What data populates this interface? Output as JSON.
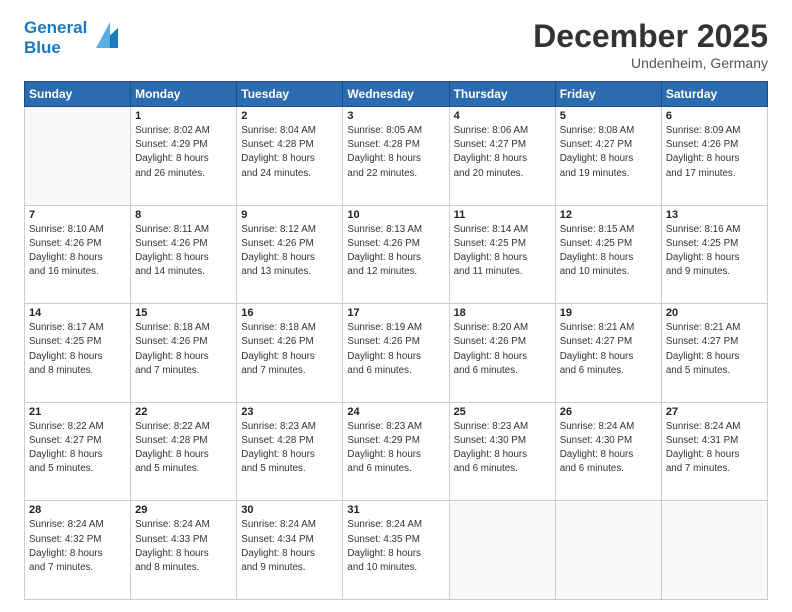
{
  "header": {
    "logo_line1": "General",
    "logo_line2": "Blue",
    "month": "December 2025",
    "location": "Undenheim, Germany"
  },
  "weekdays": [
    "Sunday",
    "Monday",
    "Tuesday",
    "Wednesday",
    "Thursday",
    "Friday",
    "Saturday"
  ],
  "weeks": [
    [
      {
        "day": "",
        "info": ""
      },
      {
        "day": "1",
        "info": "Sunrise: 8:02 AM\nSunset: 4:29 PM\nDaylight: 8 hours\nand 26 minutes."
      },
      {
        "day": "2",
        "info": "Sunrise: 8:04 AM\nSunset: 4:28 PM\nDaylight: 8 hours\nand 24 minutes."
      },
      {
        "day": "3",
        "info": "Sunrise: 8:05 AM\nSunset: 4:28 PM\nDaylight: 8 hours\nand 22 minutes."
      },
      {
        "day": "4",
        "info": "Sunrise: 8:06 AM\nSunset: 4:27 PM\nDaylight: 8 hours\nand 20 minutes."
      },
      {
        "day": "5",
        "info": "Sunrise: 8:08 AM\nSunset: 4:27 PM\nDaylight: 8 hours\nand 19 minutes."
      },
      {
        "day": "6",
        "info": "Sunrise: 8:09 AM\nSunset: 4:26 PM\nDaylight: 8 hours\nand 17 minutes."
      }
    ],
    [
      {
        "day": "7",
        "info": "Sunrise: 8:10 AM\nSunset: 4:26 PM\nDaylight: 8 hours\nand 16 minutes."
      },
      {
        "day": "8",
        "info": "Sunrise: 8:11 AM\nSunset: 4:26 PM\nDaylight: 8 hours\nand 14 minutes."
      },
      {
        "day": "9",
        "info": "Sunrise: 8:12 AM\nSunset: 4:26 PM\nDaylight: 8 hours\nand 13 minutes."
      },
      {
        "day": "10",
        "info": "Sunrise: 8:13 AM\nSunset: 4:26 PM\nDaylight: 8 hours\nand 12 minutes."
      },
      {
        "day": "11",
        "info": "Sunrise: 8:14 AM\nSunset: 4:25 PM\nDaylight: 8 hours\nand 11 minutes."
      },
      {
        "day": "12",
        "info": "Sunrise: 8:15 AM\nSunset: 4:25 PM\nDaylight: 8 hours\nand 10 minutes."
      },
      {
        "day": "13",
        "info": "Sunrise: 8:16 AM\nSunset: 4:25 PM\nDaylight: 8 hours\nand 9 minutes."
      }
    ],
    [
      {
        "day": "14",
        "info": "Sunrise: 8:17 AM\nSunset: 4:25 PM\nDaylight: 8 hours\nand 8 minutes."
      },
      {
        "day": "15",
        "info": "Sunrise: 8:18 AM\nSunset: 4:26 PM\nDaylight: 8 hours\nand 7 minutes."
      },
      {
        "day": "16",
        "info": "Sunrise: 8:18 AM\nSunset: 4:26 PM\nDaylight: 8 hours\nand 7 minutes."
      },
      {
        "day": "17",
        "info": "Sunrise: 8:19 AM\nSunset: 4:26 PM\nDaylight: 8 hours\nand 6 minutes."
      },
      {
        "day": "18",
        "info": "Sunrise: 8:20 AM\nSunset: 4:26 PM\nDaylight: 8 hours\nand 6 minutes."
      },
      {
        "day": "19",
        "info": "Sunrise: 8:21 AM\nSunset: 4:27 PM\nDaylight: 8 hours\nand 6 minutes."
      },
      {
        "day": "20",
        "info": "Sunrise: 8:21 AM\nSunset: 4:27 PM\nDaylight: 8 hours\nand 5 minutes."
      }
    ],
    [
      {
        "day": "21",
        "info": "Sunrise: 8:22 AM\nSunset: 4:27 PM\nDaylight: 8 hours\nand 5 minutes."
      },
      {
        "day": "22",
        "info": "Sunrise: 8:22 AM\nSunset: 4:28 PM\nDaylight: 8 hours\nand 5 minutes."
      },
      {
        "day": "23",
        "info": "Sunrise: 8:23 AM\nSunset: 4:28 PM\nDaylight: 8 hours\nand 5 minutes."
      },
      {
        "day": "24",
        "info": "Sunrise: 8:23 AM\nSunset: 4:29 PM\nDaylight: 8 hours\nand 6 minutes."
      },
      {
        "day": "25",
        "info": "Sunrise: 8:23 AM\nSunset: 4:30 PM\nDaylight: 8 hours\nand 6 minutes."
      },
      {
        "day": "26",
        "info": "Sunrise: 8:24 AM\nSunset: 4:30 PM\nDaylight: 8 hours\nand 6 minutes."
      },
      {
        "day": "27",
        "info": "Sunrise: 8:24 AM\nSunset: 4:31 PM\nDaylight: 8 hours\nand 7 minutes."
      }
    ],
    [
      {
        "day": "28",
        "info": "Sunrise: 8:24 AM\nSunset: 4:32 PM\nDaylight: 8 hours\nand 7 minutes."
      },
      {
        "day": "29",
        "info": "Sunrise: 8:24 AM\nSunset: 4:33 PM\nDaylight: 8 hours\nand 8 minutes."
      },
      {
        "day": "30",
        "info": "Sunrise: 8:24 AM\nSunset: 4:34 PM\nDaylight: 8 hours\nand 9 minutes."
      },
      {
        "day": "31",
        "info": "Sunrise: 8:24 AM\nSunset: 4:35 PM\nDaylight: 8 hours\nand 10 minutes."
      },
      {
        "day": "",
        "info": ""
      },
      {
        "day": "",
        "info": ""
      },
      {
        "day": "",
        "info": ""
      }
    ]
  ]
}
